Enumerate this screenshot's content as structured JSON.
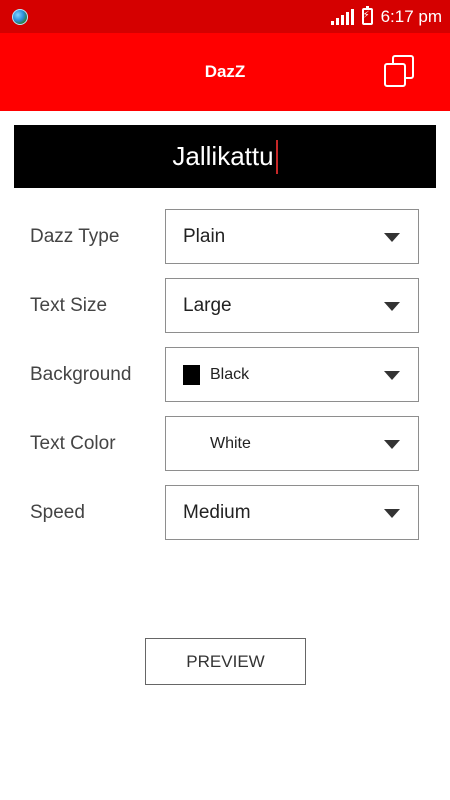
{
  "status_bar": {
    "time": "6:17 pm"
  },
  "app_bar": {
    "title": "DazZ",
    "action_icon": "copy-icon"
  },
  "preview": {
    "text": "Jallikattu"
  },
  "settings": [
    {
      "label": "Dazz Type",
      "value": "Plain"
    },
    {
      "label": "Text Size",
      "value": "Large"
    },
    {
      "label": "Background",
      "value": "Black",
      "swatch": "#000000"
    },
    {
      "label": "Text Color",
      "value": "White",
      "swatch": "#ffffff"
    },
    {
      "label": "Speed",
      "value": "Medium"
    }
  ],
  "button": {
    "preview_label": "PREVIEW"
  },
  "colors": {
    "status_bar": "#d50000",
    "app_bar": "#ff0000",
    "preview_bg": "#000000",
    "caret": "#c62828"
  }
}
